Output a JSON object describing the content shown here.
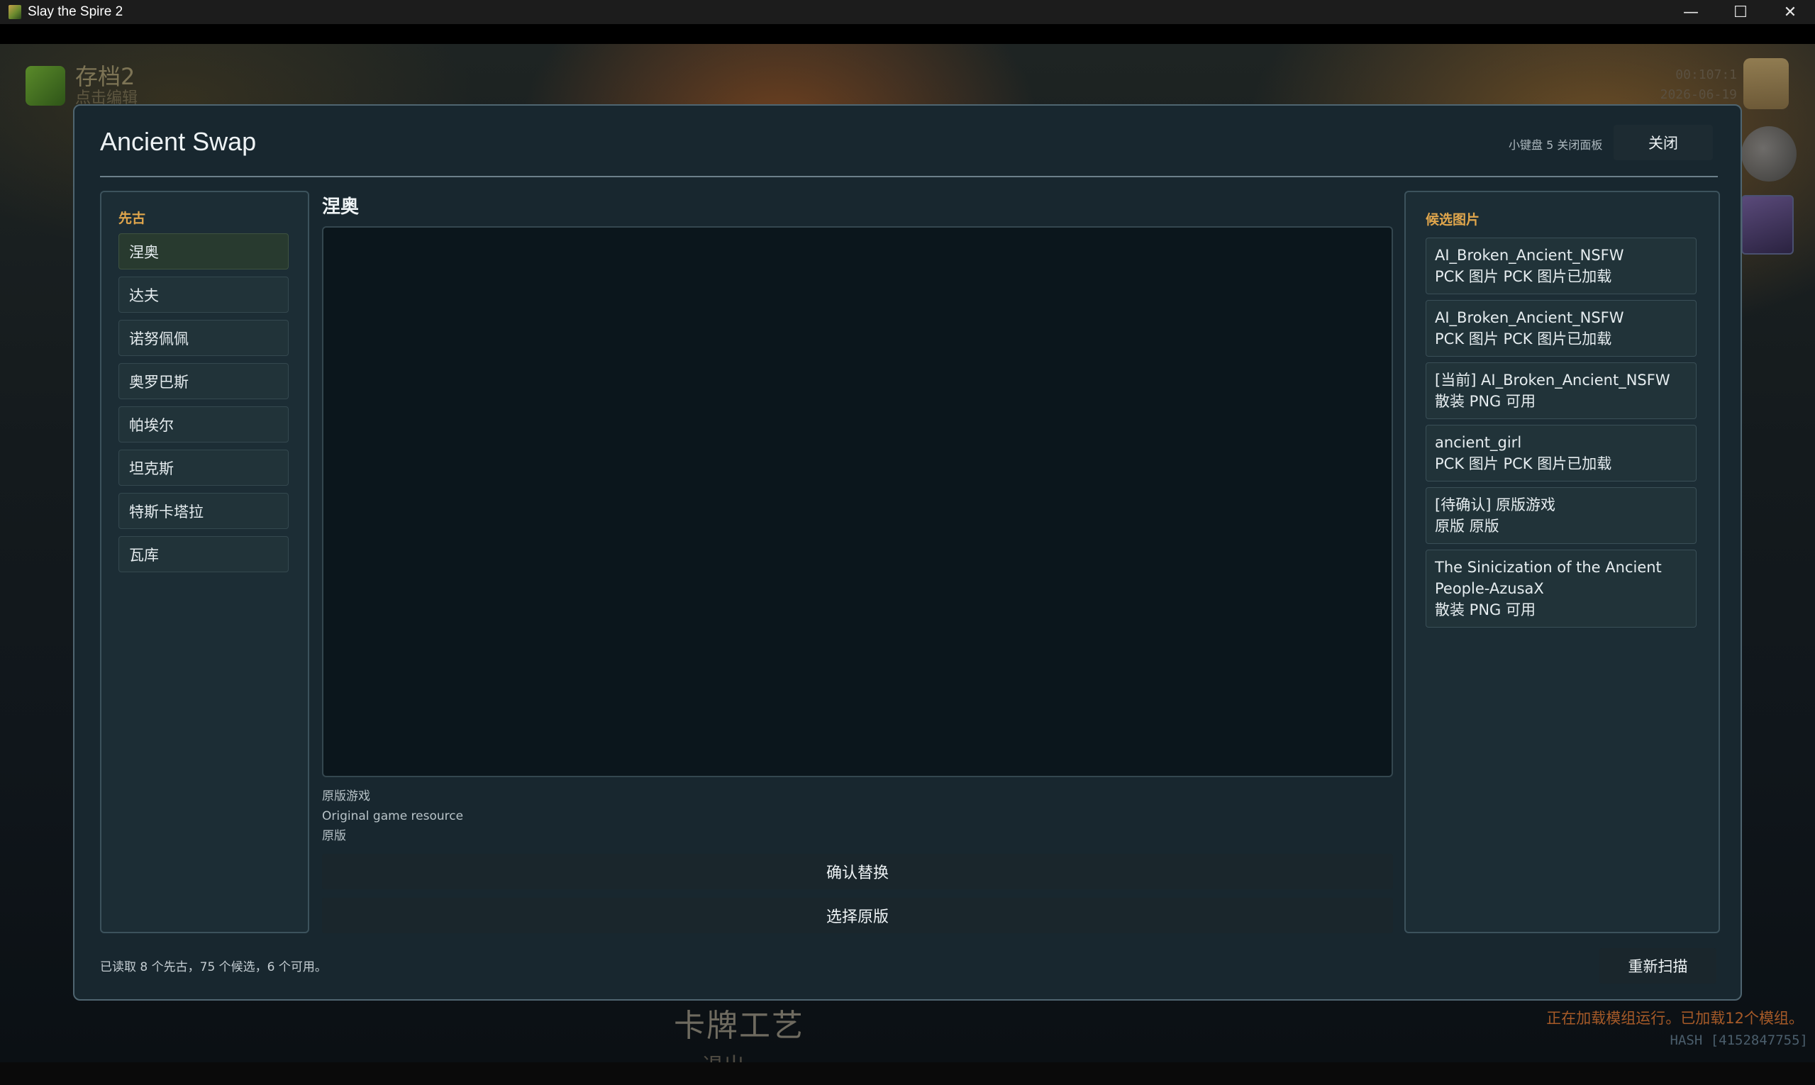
{
  "window": {
    "title": "Slay the Spire 2",
    "minimize_glyph": "—",
    "maximize_glyph": "☐",
    "close_glyph": "✕"
  },
  "background": {
    "save_slot_name": "存档2",
    "save_slot_hint": "点击编辑",
    "top_right_line1": "00:107:1",
    "top_right_line2": "2026-06-19",
    "card_label": "卡牌工艺",
    "card_sub": "退出",
    "loading_status": "正在加载模组运行。已加载12个模组。",
    "hash": "HASH [4152847755]"
  },
  "modal": {
    "title": "Ancient Swap",
    "hint": "小键盘 5 关闭面板",
    "close_label": "关闭",
    "left_pane": {
      "label": "先古",
      "items": [
        {
          "label": "涅奥"
        },
        {
          "label": "达夫"
        },
        {
          "label": "诺努佩佩"
        },
        {
          "label": "奥罗巴斯"
        },
        {
          "label": "帕埃尔"
        },
        {
          "label": "坦克斯"
        },
        {
          "label": "特斯卡塔拉"
        },
        {
          "label": "瓦库"
        }
      ],
      "selected": "涅奥"
    },
    "center": {
      "title": "涅奥",
      "info_line1": "原版游戏",
      "info_line2": "Original game resource",
      "info_line3": "原版",
      "confirm_label": "确认替换",
      "original_label": "选择原版"
    },
    "right_pane": {
      "label": "候选图片",
      "candidates": [
        {
          "name": "AI_Broken_Ancient_NSFW",
          "detail": "PCK 图片  PCK 图片已加载"
        },
        {
          "name": "AI_Broken_Ancient_NSFW",
          "detail": "PCK 图片  PCK 图片已加载"
        },
        {
          "name": "[当前] AI_Broken_Ancient_NSFW",
          "detail": "散装 PNG  可用"
        },
        {
          "name": "ancient_girl",
          "detail": "PCK 图片  PCK 图片已加载"
        },
        {
          "name": "[待确认] 原版游戏",
          "detail": "原版  原版"
        },
        {
          "name": "The Sinicization of the Ancient People-AzusaX",
          "detail": "散装 PNG  可用"
        }
      ]
    },
    "footer_status": "已读取 8 个先古，75 个候选，6 个可用。",
    "rescan_label": "重新扫描"
  },
  "colors": {
    "accent_label": "#e0a64c",
    "panel_bg": "#18272f",
    "status_orange": "#a65a28"
  }
}
